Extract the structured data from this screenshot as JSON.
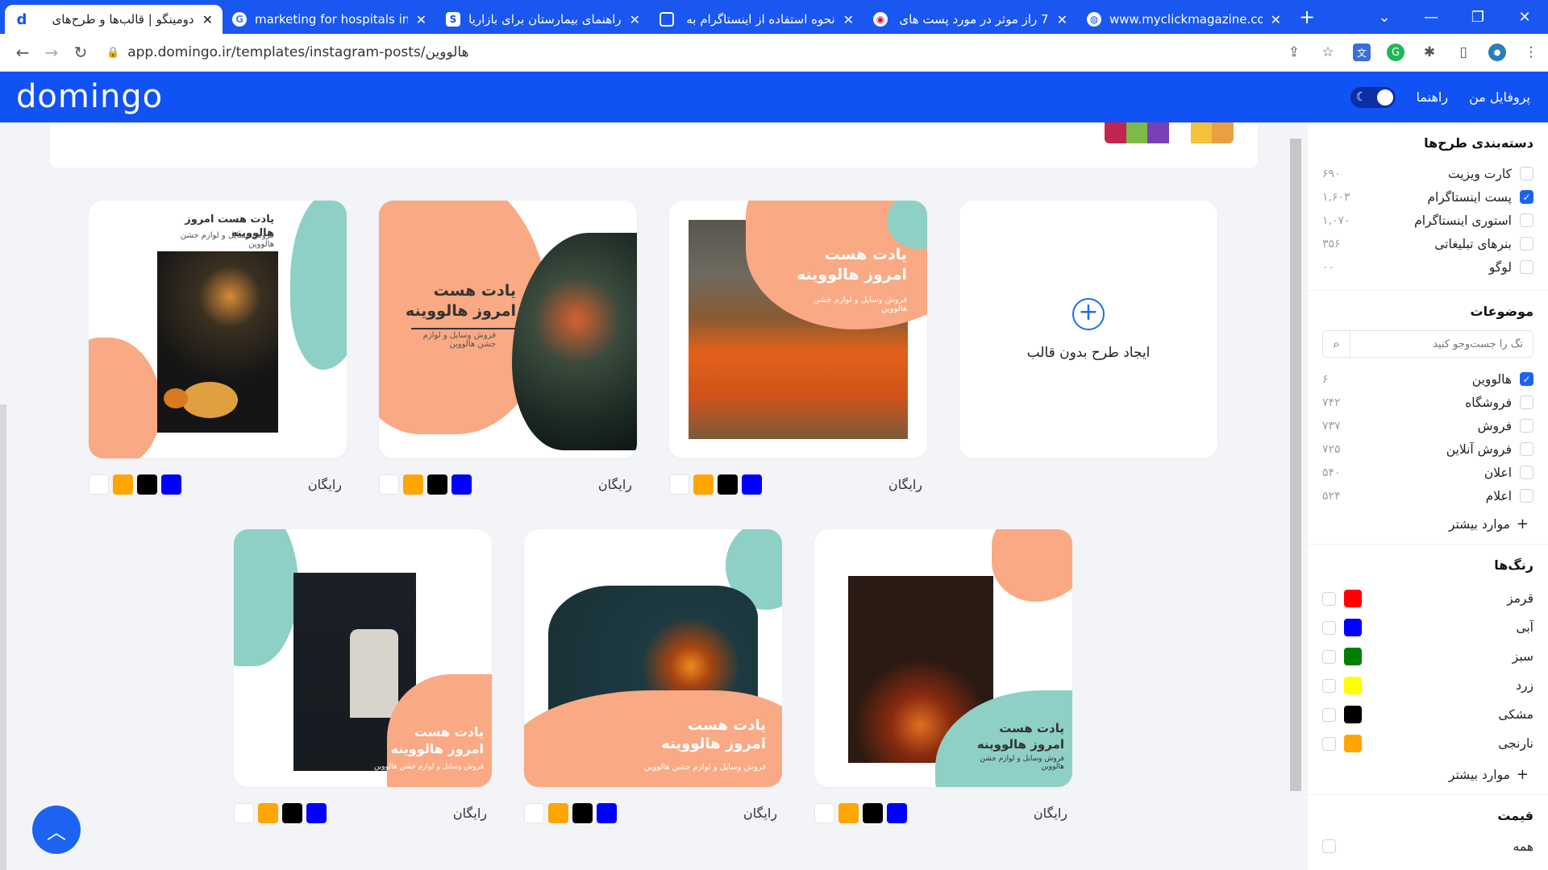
{
  "browser": {
    "tabs": [
      {
        "title": "دومینگو | قالب‌ها و طرح‌های",
        "active": true
      },
      {
        "title": "marketing for hospitals in i"
      },
      {
        "title": "راهنمای بیمارستان برای بازاریا"
      },
      {
        "title": "نحوه استفاده از اینستاگرام به"
      },
      {
        "title": "7 راز موثر در مورد پست های"
      },
      {
        "title": "www.myclickmagazine.com"
      }
    ],
    "url": "app.domingo.ir/templates/instagram-posts/هالووین"
  },
  "header": {
    "logo": "domingo",
    "nav_profile": "پروفایل من",
    "nav_help": "راهنما"
  },
  "create_blank": "ایجاد طرح بدون قالب",
  "templates": [
    {
      "title1": "یادت هست",
      "title2": "امروز هالووینه",
      "sub": "فروش وسایل و لوازم جشن هالووین",
      "price": "رایگان"
    },
    {
      "title1": "یادت هست",
      "title2": "امروز هالووینه",
      "sub": "فروش وسایل و لوازم جشن هالووین",
      "price": "رایگان"
    },
    {
      "title1": "یادت هست امروز هالووینه",
      "sub": "فروش وسایل و لوازم جشن هالووین",
      "price": "رایگان"
    },
    {
      "title1": "یادت هست",
      "title2": "امروز هالووینه",
      "sub": "فروش وسایل و لوازم جشن هالووین",
      "price": "رایگان"
    },
    {
      "title1": "یادت هست",
      "title2": "امروز هالووینه",
      "sub": "فروش وسایل و لوازم جشن هالووین",
      "price": "رایگان"
    },
    {
      "title1": "یادت هست",
      "title2": "امروز هالووینه",
      "sub": "فروش وسایل و لوازم جشن هالووین",
      "price": "رایگان"
    }
  ],
  "swatch_colors": [
    "#ffffff",
    "#ffa500",
    "#000000",
    "#0000ff"
  ],
  "sidebar": {
    "categories_title": "دسته‌بندی طرح‌ها",
    "categories": [
      {
        "label": "کارت ویزیت",
        "count": "۶۹۰",
        "checked": false
      },
      {
        "label": "پست اینستاگرام",
        "count": "۱,۶۰۳",
        "checked": true
      },
      {
        "label": "استوری اینستاگرام",
        "count": "۱,۰۷۰",
        "checked": false
      },
      {
        "label": "بنرهای تبلیغاتی",
        "count": "۳۵۶",
        "checked": false
      },
      {
        "label": "لوگو",
        "count": "۰۰",
        "checked": false
      }
    ],
    "topics_title": "موضوعات",
    "topics_search_placeholder": "تگ را جست‌وجو کنید",
    "topics": [
      {
        "label": "هالووین",
        "count": "۶",
        "checked": true
      },
      {
        "label": "فروشگاه",
        "count": "۷۴۲",
        "checked": false
      },
      {
        "label": "فروش",
        "count": "۷۳۷",
        "checked": false
      },
      {
        "label": "فروش آنلاین",
        "count": "۷۲۵",
        "checked": false
      },
      {
        "label": "اعلان",
        "count": "۵۴۰",
        "checked": false
      },
      {
        "label": "اعلام",
        "count": "۵۲۴",
        "checked": false
      }
    ],
    "more_label": "موارد بیشتر",
    "colors_title": "رنگ‌ها",
    "colors": [
      {
        "label": "قرمز",
        "hex": "#ff0000"
      },
      {
        "label": "آبی",
        "hex": "#0000ff"
      },
      {
        "label": "سبز",
        "hex": "#008000"
      },
      {
        "label": "زرد",
        "hex": "#ffff00"
      },
      {
        "label": "مشکی",
        "hex": "#000000"
      },
      {
        "label": "نارنجی",
        "hex": "#ffa500"
      }
    ],
    "price_title": "قیمت",
    "price_all": "همه"
  },
  "colors": {
    "brand": "#1152f5",
    "peach": "#f9a983",
    "teal": "#8ed0c6"
  }
}
